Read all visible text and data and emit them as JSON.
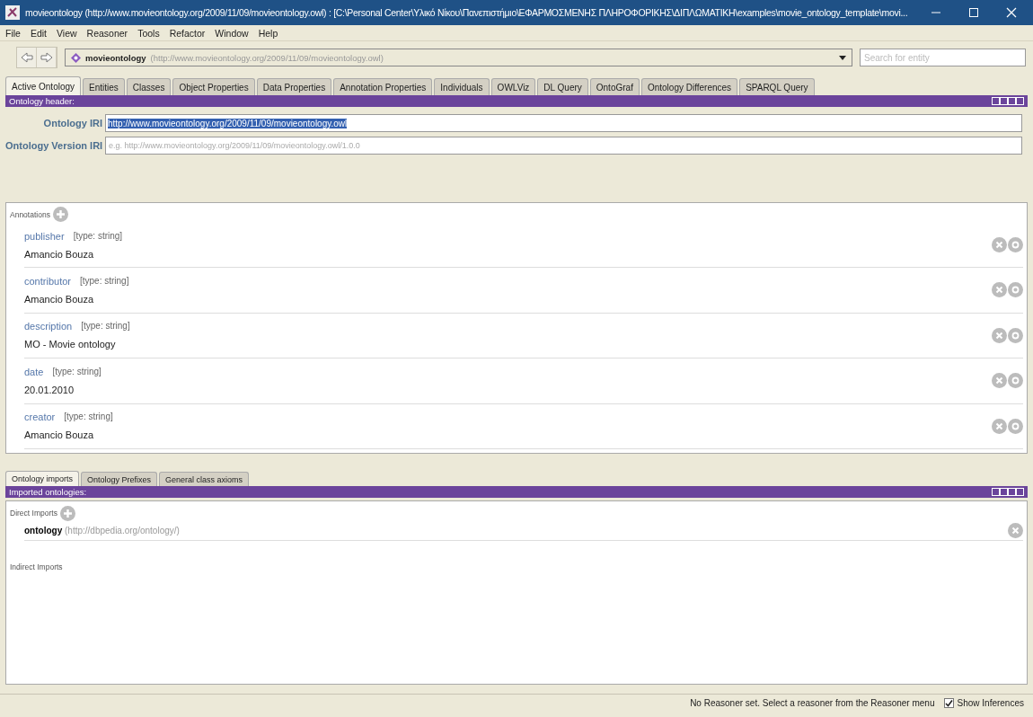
{
  "window": {
    "title": "movieontology (http://www.movieontology.org/2009/11/09/movieontology.owl)  : [C:\\Personal Center\\Υλικό Νίκου\\Πανεπιστήμιο\\ΕΦΑΡΜΟΣΜΕΝΗΣ  ΠΛΗΡΟΦΟΡΙΚΗΣ\\ΔΙΠΛΩΜΑΤΙΚΗ\\examples\\movie_ontology_template\\movi..."
  },
  "menu": [
    "File",
    "Edit",
    "View",
    "Reasoner",
    "Tools",
    "Refactor",
    "Window",
    "Help"
  ],
  "address": {
    "name": "movieontology",
    "iri": "(http://www.movieontology.org/2009/11/09/movieontology.owl)"
  },
  "search": {
    "placeholder": "Search for entity"
  },
  "tabs": [
    {
      "label": "Active Ontology",
      "selected": true
    },
    {
      "label": "Entities",
      "selected": false
    },
    {
      "label": "Classes",
      "selected": false
    },
    {
      "label": "Object Properties",
      "selected": false
    },
    {
      "label": "Data Properties",
      "selected": false
    },
    {
      "label": "Annotation Properties",
      "selected": false
    },
    {
      "label": "Individuals",
      "selected": false
    },
    {
      "label": "OWLViz",
      "selected": false
    },
    {
      "label": "DL Query",
      "selected": false
    },
    {
      "label": "OntoGraf",
      "selected": false
    },
    {
      "label": "Ontology Differences",
      "selected": false
    },
    {
      "label": "SPARQL Query",
      "selected": false
    }
  ],
  "header": {
    "title": "Ontology header:",
    "iri_label": "Ontology IRI",
    "iri": "http://www.movieontology.org/2009/11/09/movieontology.owl",
    "version_label": "Ontology Version IRI",
    "version_placeholder": "e.g. http://www.movieontology.org/2009/11/09/movieontology.owl/1.0.0"
  },
  "annotations": {
    "label": "Annotations",
    "items": [
      {
        "property": "publisher",
        "type": "[type: string]",
        "value": "Amancio Bouza"
      },
      {
        "property": "contributor",
        "type": "[type: string]",
        "value": "Amancio Bouza"
      },
      {
        "property": "description",
        "type": "[type: string]",
        "value": "MO - Movie ontology"
      },
      {
        "property": "date",
        "type": "[type: string]",
        "value": "20.01.2010"
      },
      {
        "property": "creator",
        "type": "[type: string]",
        "value": "Amancio Bouza"
      }
    ]
  },
  "lower_tabs": [
    {
      "label": "Ontology imports",
      "selected": true
    },
    {
      "label": "Ontology Prefixes",
      "selected": false
    },
    {
      "label": "General class axioms",
      "selected": false
    }
  ],
  "imports": {
    "title": "Imported ontologies:",
    "direct_label": "Direct Imports",
    "direct": [
      {
        "name": "ontology",
        "iri": "(http://dbpedia.org/ontology/)"
      }
    ],
    "indirect_label": "Indirect Imports"
  },
  "status_bar": {
    "message": "No Reasoner set. Select a reasoner from the Reasoner menu",
    "show_inferences": {
      "label": "Show Inferences",
      "checked": true
    }
  }
}
